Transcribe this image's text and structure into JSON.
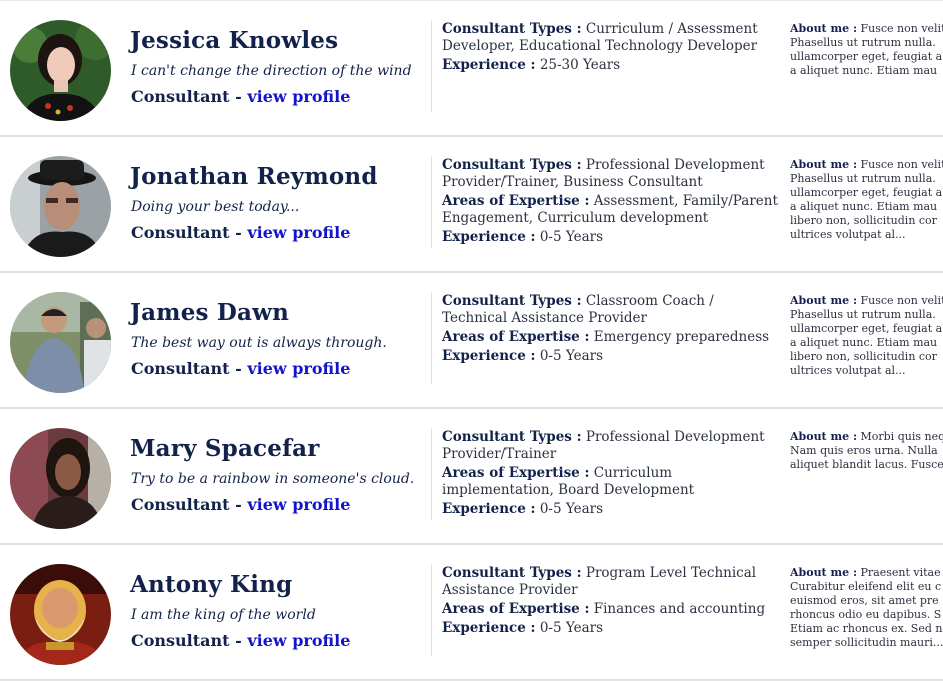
{
  "labels": {
    "role": "Consultant",
    "separator": " - ",
    "view_profile": "view profile",
    "consultant_types": "Consultant Types :",
    "areas_of_expertise": "Areas of Expertise :",
    "experience": "Experience :",
    "about_me": "About me :"
  },
  "consultants": [
    {
      "name": "Jessica Knowles",
      "quote": "I can't change the direction of the wind",
      "types": "Curriculum / Assessment Developer, Educational Technology Developer",
      "expertise": "",
      "experience": "25-30 Years",
      "about": [
        "Fusce non velit",
        "Phasellus ut rutrum nulla.",
        "ullamcorper eget, feugiat a",
        "a aliquet nunc. Etiam mau"
      ]
    },
    {
      "name": "Jonathan Reymond",
      "quote": "Doing your best today...",
      "types": "Professional Development Provider/Trainer, Business Consultant",
      "expertise": "Assessment, Family/Parent Engagement, Curriculum development",
      "experience": "0-5 Years",
      "about": [
        "Fusce non velit",
        "Phasellus ut rutrum nulla.",
        "ullamcorper eget, feugiat a",
        "a aliquet nunc. Etiam mau",
        "libero non, sollicitudin cor",
        "ultrices volutpat al..."
      ]
    },
    {
      "name": "James Dawn",
      "quote": "The best way out is always through.",
      "types": "Classroom Coach / Technical Assistance Provider",
      "expertise": "Emergency preparedness",
      "experience": "0-5 Years",
      "about": [
        "Fusce non velit",
        "Phasellus ut rutrum nulla.",
        "ullamcorper eget, feugiat a",
        "a aliquet nunc. Etiam mau",
        "libero non, sollicitudin cor",
        "ultrices volutpat al..."
      ]
    },
    {
      "name": "Mary Spacefar",
      "quote": "Try to be a rainbow in someone's cloud.",
      "types": "Professional Development Provider/Trainer",
      "expertise": "Curriculum implementation, Board Development",
      "experience": "0-5 Years",
      "about": [
        "Morbi quis neq",
        "Nam quis eros urna. Nulla",
        "aliquet blandit lacus. Fusce"
      ]
    },
    {
      "name": "Antony King",
      "quote": "I am the king of the world",
      "types": "Program Level Technical Assistance Provider",
      "expertise": "Finances and accounting",
      "experience": "0-5 Years",
      "about": [
        "Praesent vitae",
        "Curabitur eleifend elit eu c",
        "euismod eros, sit amet pre",
        "rhoncus odio eu dapibus. S",
        "Etiam ac rhoncus ex. Sed n",
        "semper sollicitudin mauri..."
      ]
    }
  ],
  "colors": {
    "heading": "#12224a",
    "link": "#1414c8",
    "text": "#2b3140",
    "row_border": "#e3e3e3"
  }
}
